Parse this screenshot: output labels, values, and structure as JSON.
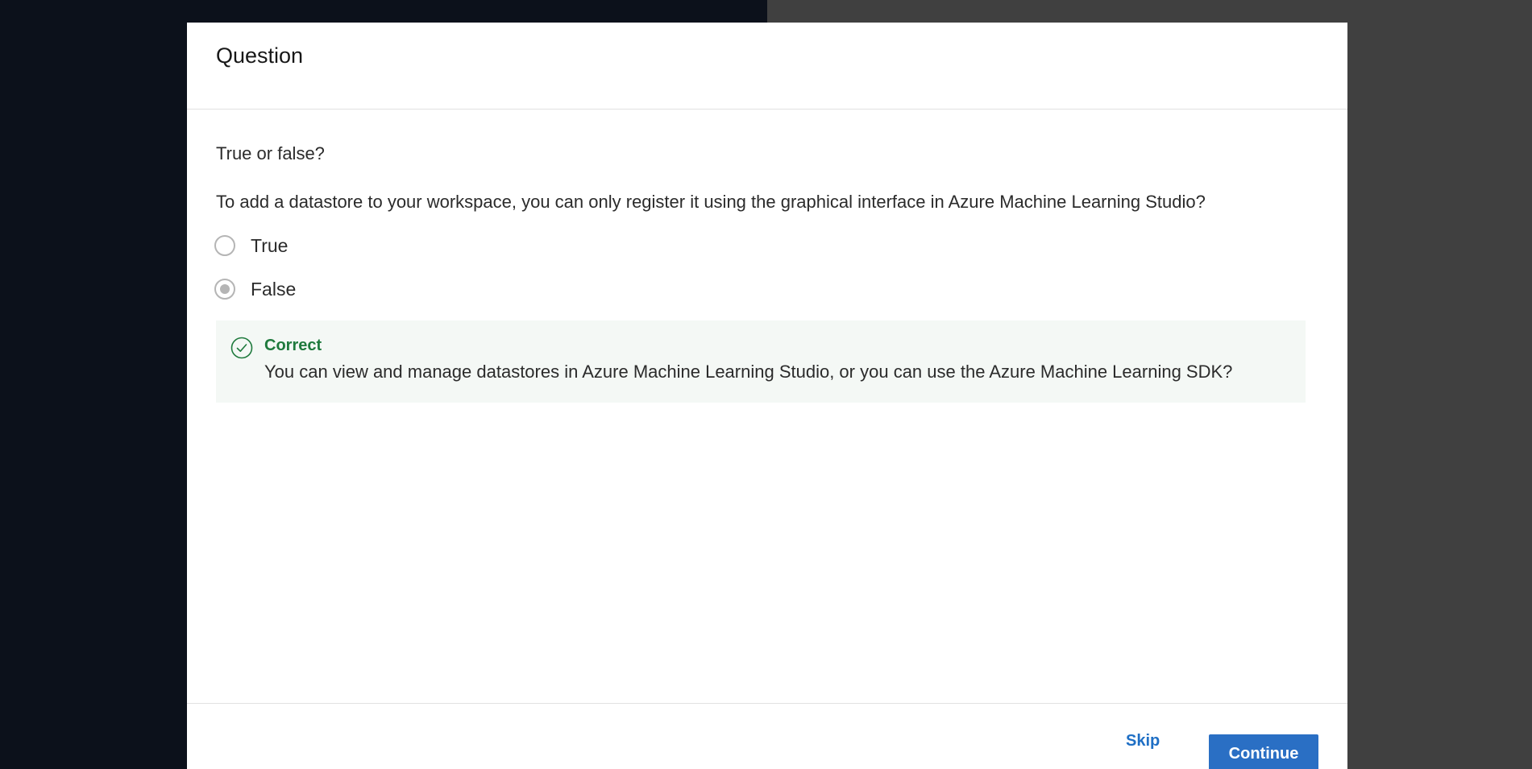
{
  "modal": {
    "title": "Question"
  },
  "question": {
    "type_label": "True or false?",
    "text": "To add a datastore to your workspace, you can only register it using the graphical interface in Azure Machine Learning Studio?",
    "options": [
      {
        "label": "True",
        "selected": false
      },
      {
        "label": "False",
        "selected": true
      }
    ]
  },
  "feedback": {
    "status": "Correct",
    "explanation": "You can view and manage datastores in Azure Machine Learning Studio, or you can use the Azure Machine Learning SDK?",
    "icon": "check-circle-icon",
    "color": "#1f7a3d"
  },
  "footer": {
    "skip_label": "Skip",
    "continue_label": "Continue"
  },
  "colors": {
    "accent": "#2a6fc4",
    "success": "#1f7a3d",
    "backdrop_left": "#0c111b",
    "backdrop_right": "#404040"
  }
}
